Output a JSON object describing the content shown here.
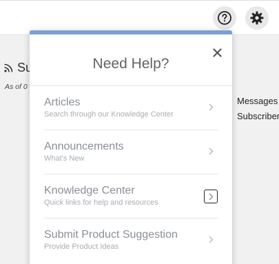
{
  "header": {
    "help_icon": "question-circle-icon",
    "settings_icon": "gear-icon"
  },
  "background": {
    "title": "Su",
    "subtitle": "As of 0",
    "right_items": [
      "Messages",
      "Subscriber"
    ]
  },
  "help_panel": {
    "accent_color": "#7c9fcf",
    "title": "Need Help?",
    "close_icon": "close-icon",
    "items": [
      {
        "title": "Articles",
        "description": "Search through our Knowledge Center"
      },
      {
        "title": "Announcements",
        "description": "What's New"
      },
      {
        "title": "Knowledge Center",
        "description": "Quick links for help and resources"
      },
      {
        "title": "Submit Product Suggestion",
        "description": "Provide Product Ideas"
      }
    ]
  }
}
